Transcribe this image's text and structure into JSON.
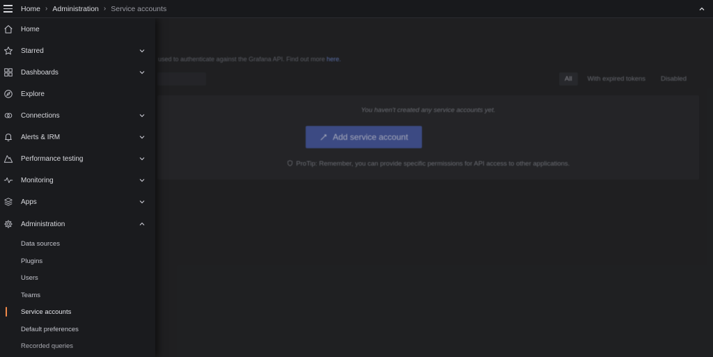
{
  "breadcrumb": {
    "items": [
      "Home",
      "Administration",
      "Service accounts"
    ],
    "separator": "›"
  },
  "page": {
    "description_text": "used to authenticate against the Grafana API. Find out more",
    "description_link": "here.",
    "filters": [
      "All",
      "With expired tokens",
      "Disabled"
    ],
    "active_filter": "All",
    "empty_message": "You haven't created any service accounts yet.",
    "add_button_label": "Add service account",
    "protip": "ProTip: Remember, you can provide specific permissions for API access to other applications."
  },
  "sidebar": {
    "items": [
      {
        "label": "Home",
        "icon": "home-icon",
        "chevron": "none"
      },
      {
        "label": "Starred",
        "icon": "star-icon",
        "chevron": "down"
      },
      {
        "label": "Dashboards",
        "icon": "apps-grid-icon",
        "chevron": "down"
      },
      {
        "label": "Explore",
        "icon": "compass-icon",
        "chevron": "none"
      },
      {
        "label": "Connections",
        "icon": "link-icon",
        "chevron": "down"
      },
      {
        "label": "Alerts & IRM",
        "icon": "bell-icon",
        "chevron": "down"
      },
      {
        "label": "Performance testing",
        "icon": "k6-icon",
        "chevron": "down"
      },
      {
        "label": "Monitoring",
        "icon": "heartbeat-icon",
        "chevron": "down"
      },
      {
        "label": "Apps",
        "icon": "layers-icon",
        "chevron": "down"
      },
      {
        "label": "Administration",
        "icon": "cog-icon",
        "chevron": "up"
      }
    ],
    "sub_items": [
      {
        "label": "Data sources"
      },
      {
        "label": "Plugins"
      },
      {
        "label": "Users"
      },
      {
        "label": "Teams"
      },
      {
        "label": "Service accounts"
      },
      {
        "label": "Default preferences"
      },
      {
        "label": "Recorded queries"
      }
    ],
    "active_sub_item": "Service accounts"
  },
  "colors": {
    "accent": "#f28a4a",
    "primary_button": "#4a5ba0",
    "sidebar_bg": "#1a1b1e",
    "page_bg": "#262729"
  }
}
